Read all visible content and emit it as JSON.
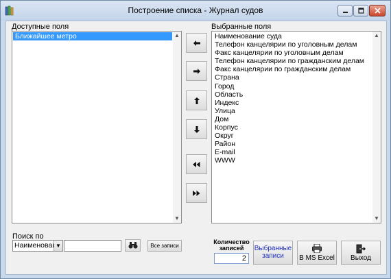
{
  "window": {
    "title": "Построение списка - Журнал судов",
    "min_label": "▭",
    "max_label": "▢",
    "close_label": "✕"
  },
  "available": {
    "label": "Доступные поля",
    "items": [
      "Ближайшее метро"
    ],
    "selected_index": 0
  },
  "selected_fields": {
    "label": "Выбранные поля",
    "items": [
      "Наименование суда",
      "Телефон канцелярии по уголовным делам",
      "Факс канцелярии по уголовным делам",
      "Телефон канцелярии по гражданским делам",
      "Факс канцелярии по гражданским делам",
      "Страна",
      "Город",
      "Область",
      "Индекс",
      "Улица",
      "Дом",
      "Корпус",
      "Округ",
      "Район",
      "E-mail",
      "WWW"
    ]
  },
  "move_buttons": {
    "left": "🡐",
    "right": "🡒",
    "up": "🡑",
    "down": "🡓",
    "all_left": "«",
    "all_right": "»"
  },
  "search": {
    "label": "Поиск по",
    "field_value": "Наименование суда",
    "query": "",
    "all_records_label": "Все записи"
  },
  "count": {
    "label": "Количество записей",
    "value": "2"
  },
  "actions": {
    "selected_records_label": "Выбранные записи",
    "selected_records_color": "#1f2fbf",
    "excel_label": "В MS Excel",
    "exit_label": "Выход"
  }
}
